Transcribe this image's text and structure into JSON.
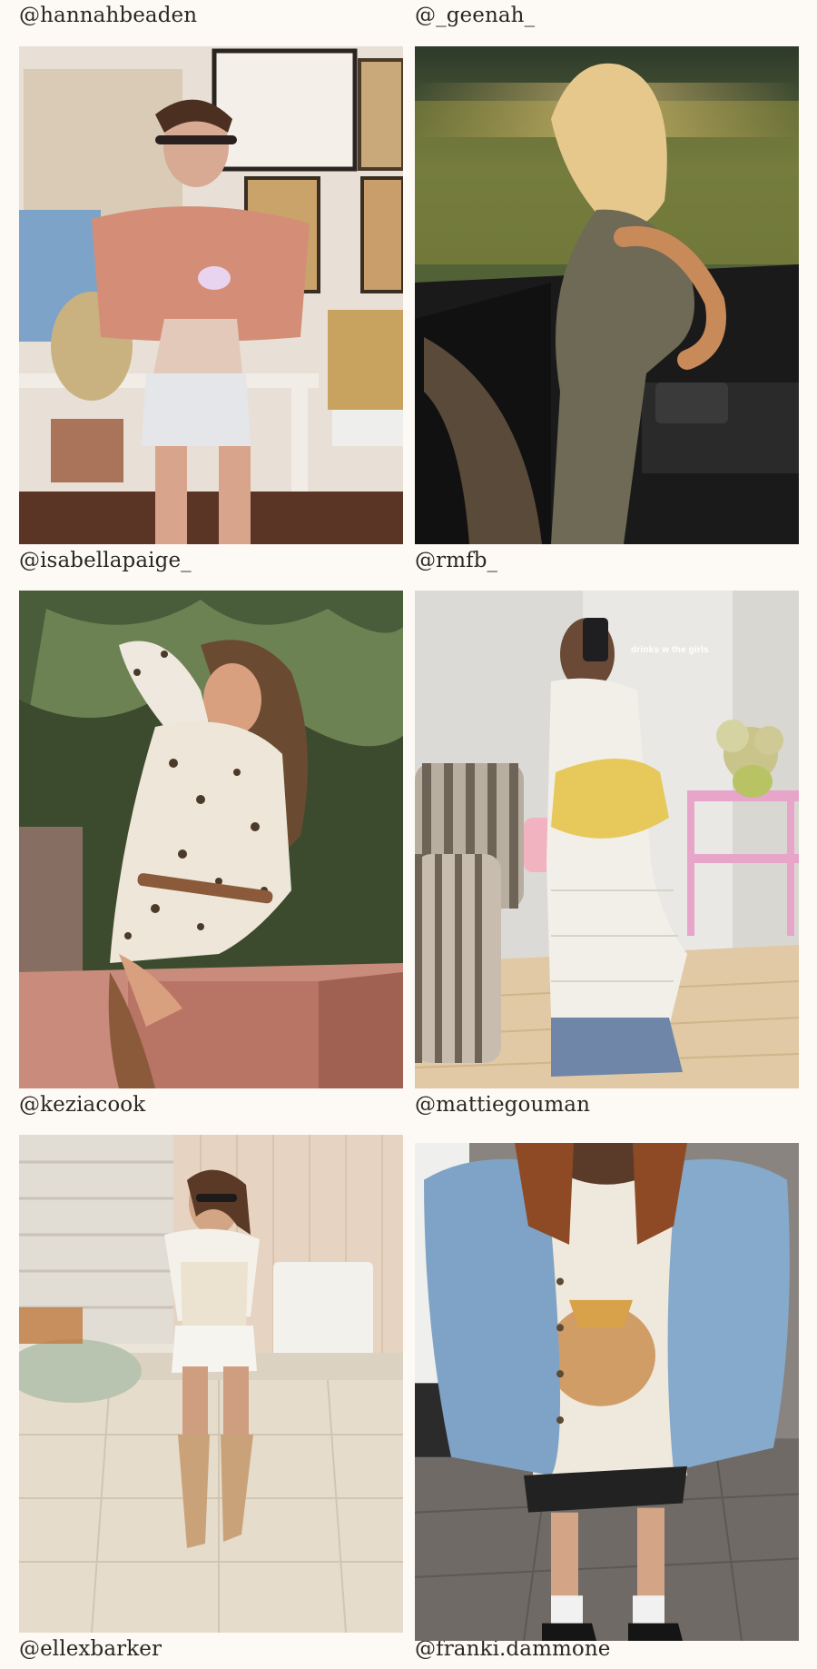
{
  "grid": {
    "items": [
      {
        "handle": "@hannahbeaden",
        "subject": "woman in pink ruffled top and satin shorts holding a teacup in a gallery-wall room"
      },
      {
        "handle": "@_geenah_",
        "subject": "blonde woman in a slip dress beside an open car door at golden hour"
      },
      {
        "handle": "@isabellapaige_",
        "subject": "woman in leopard-print dress sitting on a pink wall under palm trees"
      },
      {
        "handle": "@rmfb_",
        "subject": "mirror selfie in crochet dress with yellow clutch",
        "overlay_text": "drinks w the girls"
      },
      {
        "handle": "@keziacook",
        "subject": "woman in white corset top, lace shorts and tan boots on a patio"
      },
      {
        "handle": "@mattiegouman",
        "subject": "denim jacket with corduroy collar over a graphic tee"
      },
      {
        "handle": "@ellexbarker",
        "subject": ""
      },
      {
        "handle": "@franki.dammone",
        "subject": ""
      }
    ]
  }
}
